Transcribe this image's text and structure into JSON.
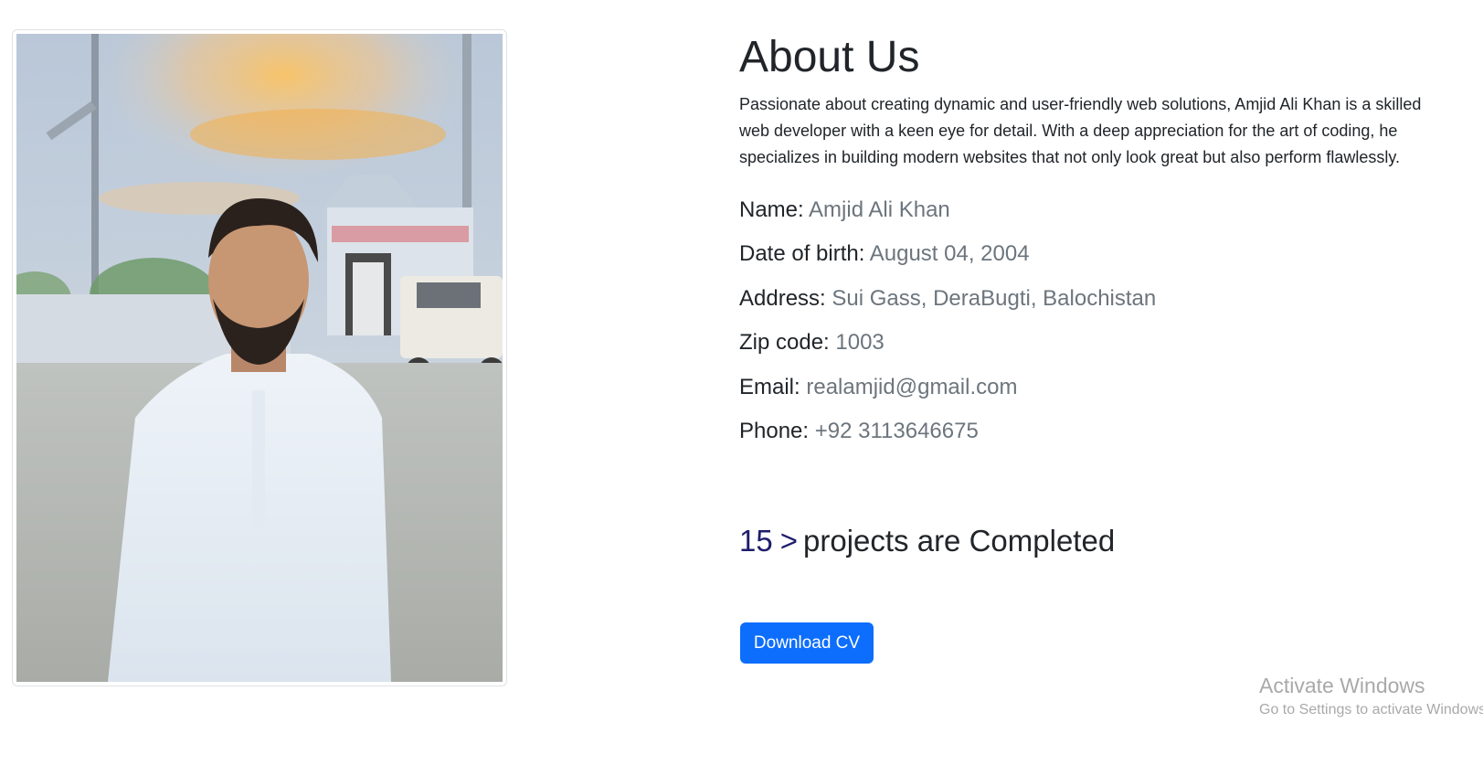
{
  "about": {
    "title": "About Us",
    "intro": "Passionate about creating dynamic and user-friendly web solutions, Amjid Ali Khan is a skilled web developer with a keen eye for detail. With a deep appreciation for the art of coding, he specializes in building modern websites that not only look great but also perform flawlessly.",
    "details": [
      {
        "label": "Name:",
        "value": "Amjid Ali Khan"
      },
      {
        "label": "Date of birth:",
        "value": "August 04, 2004"
      },
      {
        "label": "Address:",
        "value": "Sui Gass, DeraBugti, Balochistan"
      },
      {
        "label": "Zip code:",
        "value": "1003"
      },
      {
        "label": "Email:",
        "value": "realamjid@gmail.com"
      },
      {
        "label": "Phone:",
        "value": "+92 3113646675"
      }
    ],
    "projects": {
      "count": "15",
      "arrow": ">",
      "text": "projects are Completed"
    },
    "download_label": "Download CV"
  },
  "watermark": {
    "title": "Activate Windows",
    "subtitle": "Go to Settings to activate Windows."
  },
  "colors": {
    "accent": "#0d6efd",
    "value_gray": "#6c757d",
    "counter_navy": "#1f1d6b"
  }
}
